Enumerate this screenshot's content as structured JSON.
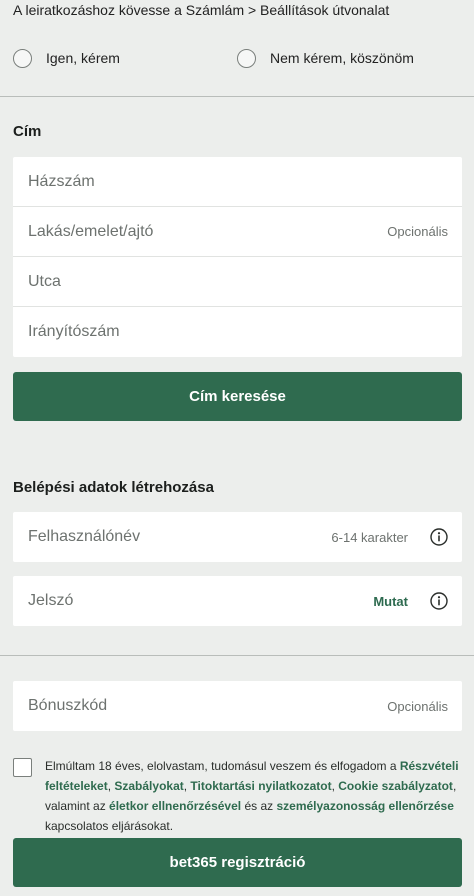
{
  "marketing": {
    "instruction": "A leiratkozáshoz kövesse a Számlám > Beállítások útvonalat",
    "option_yes": "Igen, kérem",
    "option_no": "Nem kérem, köszönöm"
  },
  "address": {
    "title": "Cím",
    "fields": [
      {
        "label": "Házszám",
        "hint": ""
      },
      {
        "label": "Lakás/emelet/ajtó",
        "hint": "Opcionális"
      },
      {
        "label": "Utca",
        "hint": ""
      },
      {
        "label": "Irányítószám",
        "hint": ""
      }
    ],
    "search_button": "Cím keresése"
  },
  "login": {
    "title": "Belépési adatok létrehozása",
    "username": {
      "label": "Felhasználónév",
      "hint": "6-14 karakter"
    },
    "password": {
      "label": "Jelszó",
      "toggle": "Mutat"
    }
  },
  "bonus": {
    "label": "Bónuszkód",
    "hint": "Opcionális"
  },
  "consent": {
    "p1": "Elmúltam 18 éves, elolvastam, tudomásul veszem és elfogadom a ",
    "l1": "Részvételi feltételeket",
    "s1": ", ",
    "l2": "Szabályokat",
    "s2": ", ",
    "l3": "Titoktartási nyilatkozatot",
    "s3": ", ",
    "l4": "Cookie szabályzatot",
    "s4": ", valamint az ",
    "l5": "életkor ellnenőrzésével",
    "s5": " és az ",
    "l6": "személyazonosság ellenőrzése",
    "s6": " kapcsolatos eljárásokat."
  },
  "register_button": "bet365 regisztráció",
  "colors": {
    "accent": "#2f6b4f",
    "background": "#eceeec"
  },
  "icons": {
    "info": "info-icon"
  }
}
